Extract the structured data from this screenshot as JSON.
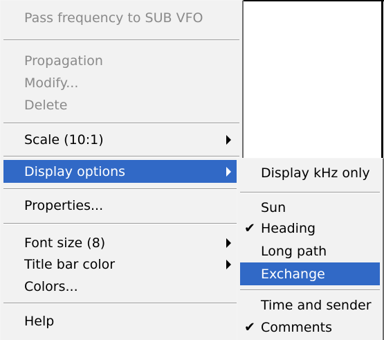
{
  "main_menu": {
    "items": [
      {
        "label": "Pass frequency to SUB VFO",
        "enabled": false
      },
      {
        "label": "Propagation",
        "enabled": false
      },
      {
        "label": "Modify...",
        "enabled": false
      },
      {
        "label": "Delete",
        "enabled": false
      },
      {
        "label": "Scale (10:1)",
        "enabled": true,
        "submenu": true
      },
      {
        "label": "Display options",
        "enabled": true,
        "submenu": true,
        "highlighted": true
      },
      {
        "label": "Properties...",
        "enabled": true
      },
      {
        "label": "Font size (8)",
        "enabled": true,
        "submenu": true
      },
      {
        "label": "Title bar color",
        "enabled": true,
        "submenu": true
      },
      {
        "label": "Colors...",
        "enabled": true
      },
      {
        "label": "Help",
        "enabled": true
      }
    ]
  },
  "display_options_submenu": {
    "items": [
      {
        "label": "Display kHz only",
        "checked": false
      },
      {
        "label": "Sun",
        "checked": false
      },
      {
        "label": "Heading",
        "checked": true
      },
      {
        "label": "Long path",
        "checked": false
      },
      {
        "label": "Exchange",
        "checked": false,
        "highlighted": true
      },
      {
        "label": "Time and sender",
        "checked": false
      },
      {
        "label": "Comments",
        "checked": true
      }
    ]
  },
  "icons": {
    "checkmark": "✔",
    "submenu_arrow": "triangle-right-icon"
  },
  "colors": {
    "menu_bg": "#f2f2f2",
    "highlight_bg": "#3169c6",
    "highlight_fg": "#ffffff",
    "disabled_fg": "#8a8a8a"
  }
}
